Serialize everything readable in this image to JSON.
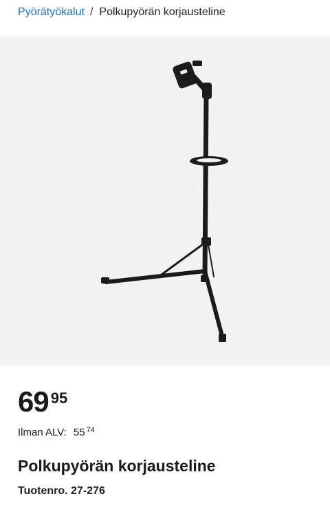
{
  "breadcrumb": {
    "parent": "Pyörätyökalut",
    "separator": "/",
    "current": "Polkupyörän korjausteline"
  },
  "product": {
    "image_alt": "bike-repair-stand",
    "price_integer": "69",
    "price_decimal": "95",
    "vat_label": "Ilman ALV:",
    "vat_integer": "55",
    "vat_decimal": "74",
    "title": "Polkupyörän korjausteline",
    "product_number": "Tuotenro. 27-276"
  }
}
